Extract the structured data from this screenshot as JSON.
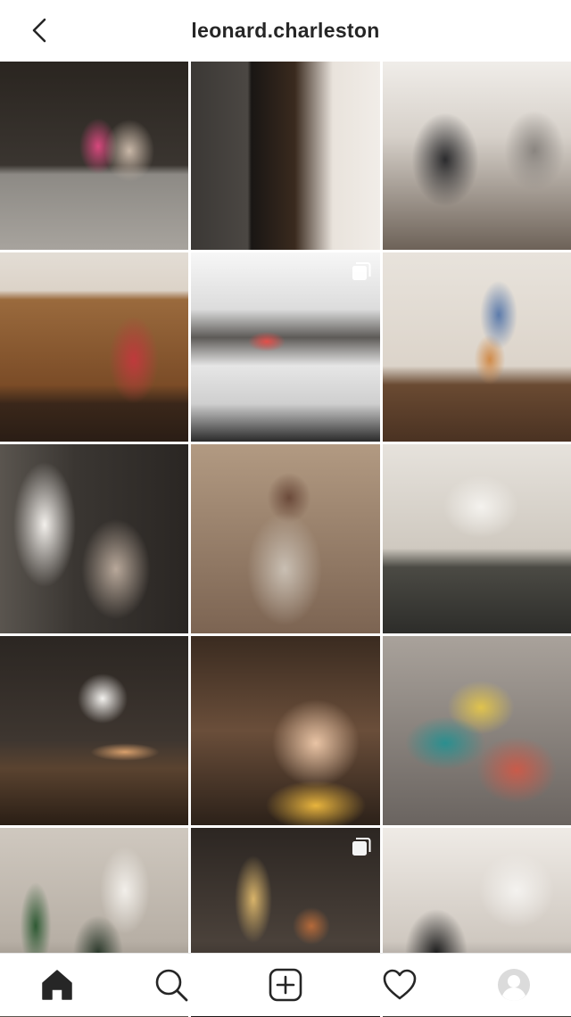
{
  "header": {
    "title": "leonard.charleston",
    "back_icon": "chevron-left-icon"
  },
  "grid": {
    "tiles": [
      {
        "description_icon": "photo",
        "multi": false
      },
      {
        "description_icon": "photo",
        "multi": false
      },
      {
        "description_icon": "photo",
        "multi": false
      },
      {
        "description_icon": "photo",
        "multi": false
      },
      {
        "description_icon": "photo",
        "multi": true
      },
      {
        "description_icon": "photo",
        "multi": false
      },
      {
        "description_icon": "photo",
        "multi": false
      },
      {
        "description_icon": "photo",
        "multi": false
      },
      {
        "description_icon": "photo",
        "multi": false
      },
      {
        "description_icon": "photo",
        "multi": false
      },
      {
        "description_icon": "photo",
        "multi": false
      },
      {
        "description_icon": "photo",
        "multi": false
      },
      {
        "description_icon": "photo",
        "multi": false
      },
      {
        "description_icon": "photo",
        "multi": true
      },
      {
        "description_icon": "photo",
        "multi": false
      }
    ]
  },
  "tab_bar": {
    "items": [
      "home-icon",
      "search-icon",
      "add-post-icon",
      "heart-icon",
      "profile-avatar-icon"
    ],
    "active": "home-icon"
  },
  "colors": {
    "text": "#262626",
    "background": "#ffffff",
    "divider": "#e6e6e6"
  }
}
